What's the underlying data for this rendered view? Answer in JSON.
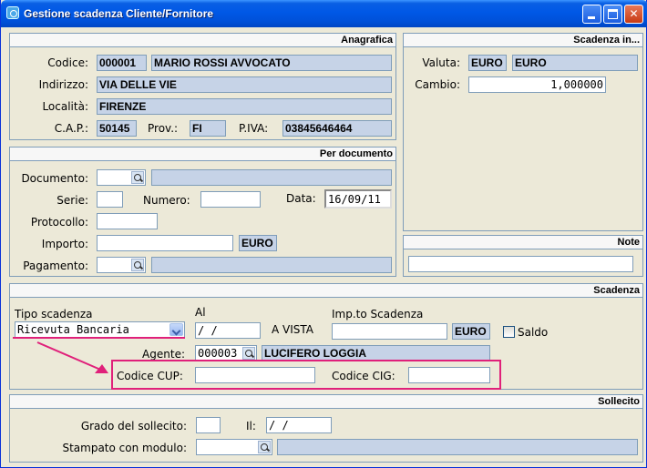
{
  "window": {
    "title": "Gestione scadenza Cliente/Fornitore"
  },
  "anagrafica": {
    "header": "Anagrafica",
    "codice_label": "Codice:",
    "codice_value": "000001",
    "nome_value": "MARIO ROSSI AVVOCATO",
    "indirizzo_label": "Indirizzo:",
    "indirizzo_value": "VIA DELLE VIE",
    "localita_label": "Località:",
    "localita_value": "FIRENZE",
    "cap_label": "C.A.P.:",
    "cap_value": "50145",
    "prov_label": "Prov.:",
    "prov_value": "FI",
    "piva_label": "P.IVA:",
    "piva_value": "03845646464"
  },
  "scadenza_in": {
    "header": "Scadenza in...",
    "valuta_label": "Valuta:",
    "valuta_code": "EURO",
    "valuta_desc": "EURO",
    "cambio_label": "Cambio:",
    "cambio_value": "1,000000"
  },
  "per_documento": {
    "header": "Per documento",
    "documento_label": "Documento:",
    "serie_label": "Serie:",
    "numero_label": "Numero:",
    "data_label": "Data:",
    "data_value": "16/09/11",
    "protocollo_label": "Protocollo:",
    "importo_label": "Importo:",
    "importo_currency": "EURO",
    "pagamento_label": "Pagamento:"
  },
  "note": {
    "header": "Note"
  },
  "scadenza": {
    "header": "Scadenza",
    "tipo_label": "Tipo scadenza",
    "tipo_value": "Ricevuta Bancaria",
    "al_label": "Al",
    "al_value": " /   /",
    "a_vista_label": "A VISTA",
    "impto_label": "Imp.to Scadenza",
    "impto_currency": "EURO",
    "saldo_label": "Saldo",
    "agente_label": "Agente:",
    "agente_code": "000003",
    "agente_name": "LUCIFERO LOGGIA",
    "cup_label": "Codice CUP:",
    "cig_label": "Codice CIG:"
  },
  "sollecito": {
    "header": "Sollecito",
    "grado_label": "Grado del sollecito:",
    "il_label": "Il:",
    "il_value": " /   /",
    "modulo_label": "Stampato con modulo:"
  },
  "colors": {
    "annotation": "#e0207a",
    "readonly_field": "#c6d3e7",
    "titlebar": "#0058e6"
  }
}
